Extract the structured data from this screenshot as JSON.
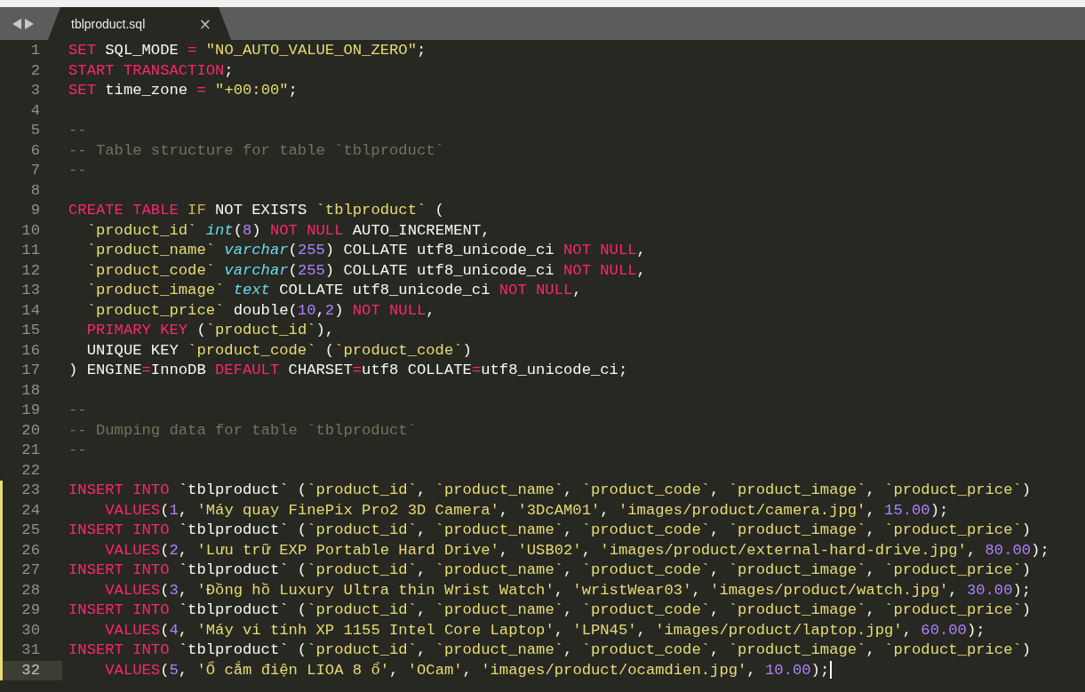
{
  "tab": {
    "title": "tblproduct.sql",
    "close": "×"
  },
  "lines": [
    {
      "n": "1",
      "modified": false,
      "selected": false,
      "tokens": [
        {
          "kind": "kw",
          "text": "SET"
        },
        {
          "kind": "pl",
          "text": " SQL_MODE "
        },
        {
          "kind": "kw",
          "text": "="
        },
        {
          "kind": "str",
          "text": " \"NO_AUTO_VALUE_ON_ZERO\""
        },
        {
          "kind": "pl",
          "text": ";"
        }
      ]
    },
    {
      "n": "2",
      "modified": false,
      "selected": false,
      "tokens": [
        {
          "kind": "kw",
          "text": "START TRANSACTION"
        },
        {
          "kind": "pl",
          "text": ";"
        }
      ]
    },
    {
      "n": "3",
      "modified": false,
      "selected": false,
      "tokens": [
        {
          "kind": "kw",
          "text": "SET"
        },
        {
          "kind": "pl",
          "text": " time_zone "
        },
        {
          "kind": "kw",
          "text": "="
        },
        {
          "kind": "str",
          "text": " \"+00:00\""
        },
        {
          "kind": "pl",
          "text": ";"
        }
      ]
    },
    {
      "n": "4",
      "modified": false,
      "selected": false
    },
    {
      "n": "5",
      "modified": false,
      "selected": false,
      "tokens": [
        {
          "kind": "cm",
          "text": "--"
        }
      ]
    },
    {
      "n": "6",
      "modified": false,
      "selected": false,
      "tokens": [
        {
          "kind": "cm",
          "text": "-- Table structure for table `tblproduct`"
        }
      ]
    },
    {
      "n": "7",
      "modified": false,
      "selected": false,
      "tokens": [
        {
          "kind": "cm",
          "text": "--"
        }
      ]
    },
    {
      "n": "8",
      "modified": false,
      "selected": false
    },
    {
      "n": "9",
      "modified": false,
      "selected": false,
      "tokens": [
        {
          "kind": "kw",
          "text": "CREATE TABLE"
        },
        {
          "kind": "ctrl",
          "text": " IF"
        },
        {
          "kind": "pl",
          "text": " NOT EXISTS "
        },
        {
          "kind": "str",
          "text": "`tblproduct`"
        },
        {
          "kind": "pl",
          "text": " ("
        }
      ]
    },
    {
      "n": "10",
      "modified": false,
      "selected": false,
      "tokens": [
        {
          "kind": "str",
          "text": "  `product_id`"
        },
        {
          "kind": "type",
          "text": " int"
        },
        {
          "kind": "pl",
          "text": "("
        },
        {
          "kind": "num",
          "text": "8"
        },
        {
          "kind": "pl",
          "text": ") "
        },
        {
          "kind": "kw",
          "text": "NOT NULL"
        },
        {
          "kind": "pl",
          "text": " AUTO_INCREMENT,"
        }
      ]
    },
    {
      "n": "11",
      "modified": false,
      "selected": false,
      "tokens": [
        {
          "kind": "str",
          "text": "  `product_name`"
        },
        {
          "kind": "type",
          "text": " varchar"
        },
        {
          "kind": "pl",
          "text": "("
        },
        {
          "kind": "num",
          "text": "255"
        },
        {
          "kind": "pl",
          "text": ") COLLATE utf8_unicode_ci "
        },
        {
          "kind": "kw",
          "text": "NOT NULL"
        },
        {
          "kind": "pl",
          "text": ","
        }
      ]
    },
    {
      "n": "12",
      "modified": false,
      "selected": false,
      "tokens": [
        {
          "kind": "str",
          "text": "  `product_code`"
        },
        {
          "kind": "type",
          "text": " varchar"
        },
        {
          "kind": "pl",
          "text": "("
        },
        {
          "kind": "num",
          "text": "255"
        },
        {
          "kind": "pl",
          "text": ") COLLATE utf8_unicode_ci "
        },
        {
          "kind": "kw",
          "text": "NOT NULL"
        },
        {
          "kind": "pl",
          "text": ","
        }
      ]
    },
    {
      "n": "13",
      "modified": false,
      "selected": false,
      "tokens": [
        {
          "kind": "str",
          "text": "  `product_image`"
        },
        {
          "kind": "type",
          "text": " text"
        },
        {
          "kind": "pl",
          "text": " COLLATE utf8_unicode_ci "
        },
        {
          "kind": "kw",
          "text": "NOT NULL"
        },
        {
          "kind": "pl",
          "text": ","
        }
      ]
    },
    {
      "n": "14",
      "modified": false,
      "selected": false,
      "tokens": [
        {
          "kind": "str",
          "text": "  `product_price`"
        },
        {
          "kind": "pl",
          "text": " double("
        },
        {
          "kind": "num",
          "text": "10"
        },
        {
          "kind": "pl",
          "text": ","
        },
        {
          "kind": "num",
          "text": "2"
        },
        {
          "kind": "pl",
          "text": ") "
        },
        {
          "kind": "kw",
          "text": "NOT NULL"
        },
        {
          "kind": "pl",
          "text": ","
        }
      ]
    },
    {
      "n": "15",
      "modified": false,
      "selected": false,
      "tokens": [
        {
          "kind": "kw",
          "text": "  PRIMARY KEY"
        },
        {
          "kind": "pl",
          "text": " ("
        },
        {
          "kind": "str",
          "text": "`product_id`"
        },
        {
          "kind": "pl",
          "text": "),"
        }
      ]
    },
    {
      "n": "16",
      "modified": false,
      "selected": false,
      "tokens": [
        {
          "kind": "pl",
          "text": "  UNIQUE KEY "
        },
        {
          "kind": "str",
          "text": "`product_code`"
        },
        {
          "kind": "pl",
          "text": " ("
        },
        {
          "kind": "str",
          "text": "`product_code`"
        },
        {
          "kind": "pl",
          "text": ")"
        }
      ]
    },
    {
      "n": "17",
      "modified": false,
      "selected": false,
      "tokens": [
        {
          "kind": "pl",
          "text": ") ENGINE"
        },
        {
          "kind": "kw",
          "text": "="
        },
        {
          "kind": "pl",
          "text": "InnoDB "
        },
        {
          "kind": "kw",
          "text": "DEFAULT"
        },
        {
          "kind": "pl",
          "text": " CHARSET"
        },
        {
          "kind": "kw",
          "text": "="
        },
        {
          "kind": "pl",
          "text": "utf8 COLLATE"
        },
        {
          "kind": "kw",
          "text": "="
        },
        {
          "kind": "pl",
          "text": "utf8_unicode_ci;"
        }
      ]
    },
    {
      "n": "18",
      "modified": false,
      "selected": false
    },
    {
      "n": "19",
      "modified": false,
      "selected": false,
      "tokens": [
        {
          "kind": "cm",
          "text": "--"
        }
      ]
    },
    {
      "n": "20",
      "modified": false,
      "selected": false,
      "tokens": [
        {
          "kind": "cm",
          "text": "-- Dumping data for table `tblproduct`"
        }
      ]
    },
    {
      "n": "21",
      "modified": false,
      "selected": false,
      "tokens": [
        {
          "kind": "cm",
          "text": "--"
        }
      ]
    },
    {
      "n": "22",
      "modified": false,
      "selected": false
    },
    {
      "n": "23",
      "modified": true,
      "selected": false,
      "tokens": [
        {
          "kind": "kw",
          "text": "INSERT INTO"
        },
        {
          "kind": "pl",
          "text": " `tblproduct` ("
        },
        {
          "kind": "str",
          "text": "`product_id`"
        },
        {
          "kind": "pl",
          "text": ", "
        },
        {
          "kind": "str",
          "text": "`product_name`"
        },
        {
          "kind": "pl",
          "text": ", "
        },
        {
          "kind": "str",
          "text": "`product_code`"
        },
        {
          "kind": "pl",
          "text": ", "
        },
        {
          "kind": "str",
          "text": "`product_image`"
        },
        {
          "kind": "pl",
          "text": ", "
        },
        {
          "kind": "str",
          "text": "`product_price`"
        },
        {
          "kind": "pl",
          "text": ")"
        }
      ]
    },
    {
      "n": "24",
      "modified": true,
      "selected": false,
      "tokens": [
        {
          "kind": "kw",
          "text": "    VALUES"
        },
        {
          "kind": "pl",
          "text": "("
        },
        {
          "kind": "num",
          "text": "1"
        },
        {
          "kind": "pl",
          "text": ", "
        },
        {
          "kind": "str",
          "text": "'Máy quay FinePix Pro2 3D Camera'"
        },
        {
          "kind": "pl",
          "text": ", "
        },
        {
          "kind": "str",
          "text": "'3DcAM01'"
        },
        {
          "kind": "pl",
          "text": ", "
        },
        {
          "kind": "str",
          "text": "'images/product/camera.jpg'"
        },
        {
          "kind": "pl",
          "text": ", "
        },
        {
          "kind": "num",
          "text": "15.00"
        },
        {
          "kind": "pl",
          "text": ");"
        }
      ]
    },
    {
      "n": "25",
      "modified": true,
      "selected": false,
      "tokens": [
        {
          "kind": "kw",
          "text": "INSERT INTO"
        },
        {
          "kind": "pl",
          "text": " `tblproduct` ("
        },
        {
          "kind": "str",
          "text": "`product_id`"
        },
        {
          "kind": "pl",
          "text": ", "
        },
        {
          "kind": "str",
          "text": "`product_name`"
        },
        {
          "kind": "pl",
          "text": ", "
        },
        {
          "kind": "str",
          "text": "`product_code`"
        },
        {
          "kind": "pl",
          "text": ", "
        },
        {
          "kind": "str",
          "text": "`product_image`"
        },
        {
          "kind": "pl",
          "text": ", "
        },
        {
          "kind": "str",
          "text": "`product_price`"
        },
        {
          "kind": "pl",
          "text": ")"
        }
      ]
    },
    {
      "n": "26",
      "modified": true,
      "selected": false,
      "tokens": [
        {
          "kind": "kw",
          "text": "    VALUES"
        },
        {
          "kind": "pl",
          "text": "("
        },
        {
          "kind": "num",
          "text": "2"
        },
        {
          "kind": "pl",
          "text": ", "
        },
        {
          "kind": "str",
          "text": "'Lưu trữ EXP Portable Hard Drive'"
        },
        {
          "kind": "pl",
          "text": ", "
        },
        {
          "kind": "str",
          "text": "'USB02'"
        },
        {
          "kind": "pl",
          "text": ", "
        },
        {
          "kind": "str",
          "text": "'images/product/external-hard-drive.jpg'"
        },
        {
          "kind": "pl",
          "text": ", "
        },
        {
          "kind": "num",
          "text": "80.00"
        },
        {
          "kind": "pl",
          "text": ");"
        }
      ]
    },
    {
      "n": "27",
      "modified": true,
      "selected": false,
      "tokens": [
        {
          "kind": "kw",
          "text": "INSERT INTO"
        },
        {
          "kind": "pl",
          "text": " `tblproduct` ("
        },
        {
          "kind": "str",
          "text": "`product_id`"
        },
        {
          "kind": "pl",
          "text": ", "
        },
        {
          "kind": "str",
          "text": "`product_name`"
        },
        {
          "kind": "pl",
          "text": ", "
        },
        {
          "kind": "str",
          "text": "`product_code`"
        },
        {
          "kind": "pl",
          "text": ", "
        },
        {
          "kind": "str",
          "text": "`product_image`"
        },
        {
          "kind": "pl",
          "text": ", "
        },
        {
          "kind": "str",
          "text": "`product_price`"
        },
        {
          "kind": "pl",
          "text": ")"
        }
      ]
    },
    {
      "n": "28",
      "modified": true,
      "selected": false,
      "tokens": [
        {
          "kind": "kw",
          "text": "    VALUES"
        },
        {
          "kind": "pl",
          "text": "("
        },
        {
          "kind": "num",
          "text": "3"
        },
        {
          "kind": "pl",
          "text": ", "
        },
        {
          "kind": "str",
          "text": "'Đồng hồ Luxury Ultra thin Wrist Watch'"
        },
        {
          "kind": "pl",
          "text": ", "
        },
        {
          "kind": "str",
          "text": "'wristWear03'"
        },
        {
          "kind": "pl",
          "text": ", "
        },
        {
          "kind": "str",
          "text": "'images/product/watch.jpg'"
        },
        {
          "kind": "pl",
          "text": ", "
        },
        {
          "kind": "num",
          "text": "30.00"
        },
        {
          "kind": "pl",
          "text": ");"
        }
      ]
    },
    {
      "n": "29",
      "modified": true,
      "selected": false,
      "tokens": [
        {
          "kind": "kw",
          "text": "INSERT INTO"
        },
        {
          "kind": "pl",
          "text": " `tblproduct` ("
        },
        {
          "kind": "str",
          "text": "`product_id`"
        },
        {
          "kind": "pl",
          "text": ", "
        },
        {
          "kind": "str",
          "text": "`product_name`"
        },
        {
          "kind": "pl",
          "text": ", "
        },
        {
          "kind": "str",
          "text": "`product_code`"
        },
        {
          "kind": "pl",
          "text": ", "
        },
        {
          "kind": "str",
          "text": "`product_image`"
        },
        {
          "kind": "pl",
          "text": ", "
        },
        {
          "kind": "str",
          "text": "`product_price`"
        },
        {
          "kind": "pl",
          "text": ")"
        }
      ]
    },
    {
      "n": "30",
      "modified": true,
      "selected": false,
      "tokens": [
        {
          "kind": "kw",
          "text": "    VALUES"
        },
        {
          "kind": "pl",
          "text": "("
        },
        {
          "kind": "num",
          "text": "4"
        },
        {
          "kind": "pl",
          "text": ", "
        },
        {
          "kind": "str",
          "text": "'Máy vi tính XP 1155 Intel Core Laptop'"
        },
        {
          "kind": "pl",
          "text": ", "
        },
        {
          "kind": "str",
          "text": "'LPN45'"
        },
        {
          "kind": "pl",
          "text": ", "
        },
        {
          "kind": "str",
          "text": "'images/product/laptop.jpg'"
        },
        {
          "kind": "pl",
          "text": ", "
        },
        {
          "kind": "num",
          "text": "60.00"
        },
        {
          "kind": "pl",
          "text": ");"
        }
      ]
    },
    {
      "n": "31",
      "modified": true,
      "selected": false,
      "tokens": [
        {
          "kind": "kw",
          "text": "INSERT INTO"
        },
        {
          "kind": "pl",
          "text": " `tblproduct` ("
        },
        {
          "kind": "str",
          "text": "`product_id`"
        },
        {
          "kind": "pl",
          "text": ", "
        },
        {
          "kind": "str",
          "text": "`product_name`"
        },
        {
          "kind": "pl",
          "text": ", "
        },
        {
          "kind": "str",
          "text": "`product_code`"
        },
        {
          "kind": "pl",
          "text": ", "
        },
        {
          "kind": "str",
          "text": "`product_image`"
        },
        {
          "kind": "pl",
          "text": ", "
        },
        {
          "kind": "str",
          "text": "`product_price`"
        },
        {
          "kind": "pl",
          "text": ")"
        }
      ]
    },
    {
      "n": "32",
      "modified": true,
      "selected": true,
      "tokens": [
        {
          "kind": "kw",
          "text": "    VALUES"
        },
        {
          "kind": "pl",
          "text": "("
        },
        {
          "kind": "num",
          "text": "5"
        },
        {
          "kind": "pl",
          "text": ", "
        },
        {
          "kind": "str",
          "text": "'Ổ cắm điện LIOA 8 ổ'"
        },
        {
          "kind": "pl",
          "text": ", "
        },
        {
          "kind": "str",
          "text": "'OCam'"
        },
        {
          "kind": "pl",
          "text": ", "
        },
        {
          "kind": "str",
          "text": "'images/product/ocamdien.jpg'"
        },
        {
          "kind": "pl",
          "text": ", "
        },
        {
          "kind": "num",
          "text": "10.00"
        },
        {
          "kind": "pl",
          "text": ");"
        }
      ]
    }
  ]
}
